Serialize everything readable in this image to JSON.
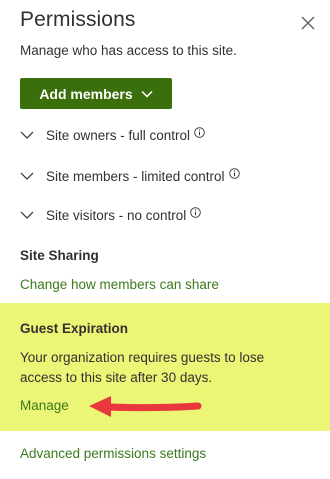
{
  "panel": {
    "title": "Permissions",
    "subtitle": "Manage who has access to this site.",
    "add_members_label": "Add members"
  },
  "groups": [
    {
      "label": "Site owners - full control"
    },
    {
      "label": "Site members - limited control"
    },
    {
      "label": "Site visitors - no control"
    }
  ],
  "site_sharing": {
    "heading": "Site Sharing",
    "link": "Change how members can share"
  },
  "guest_expiration": {
    "heading": "Guest Expiration",
    "description": "Your organization requires guests to lose access to this site after 30 days.",
    "manage_link": "Manage",
    "highlight_color": "#ebf576",
    "arrow_color": "#e8373d"
  },
  "advanced_link": "Advanced permissions settings",
  "colors": {
    "accent_green": "#3a6f0c",
    "link_green": "#3a7a1c"
  },
  "icons": [
    "close-icon",
    "chevron-down-icon",
    "info-icon",
    "arrow-annotation-icon"
  ]
}
